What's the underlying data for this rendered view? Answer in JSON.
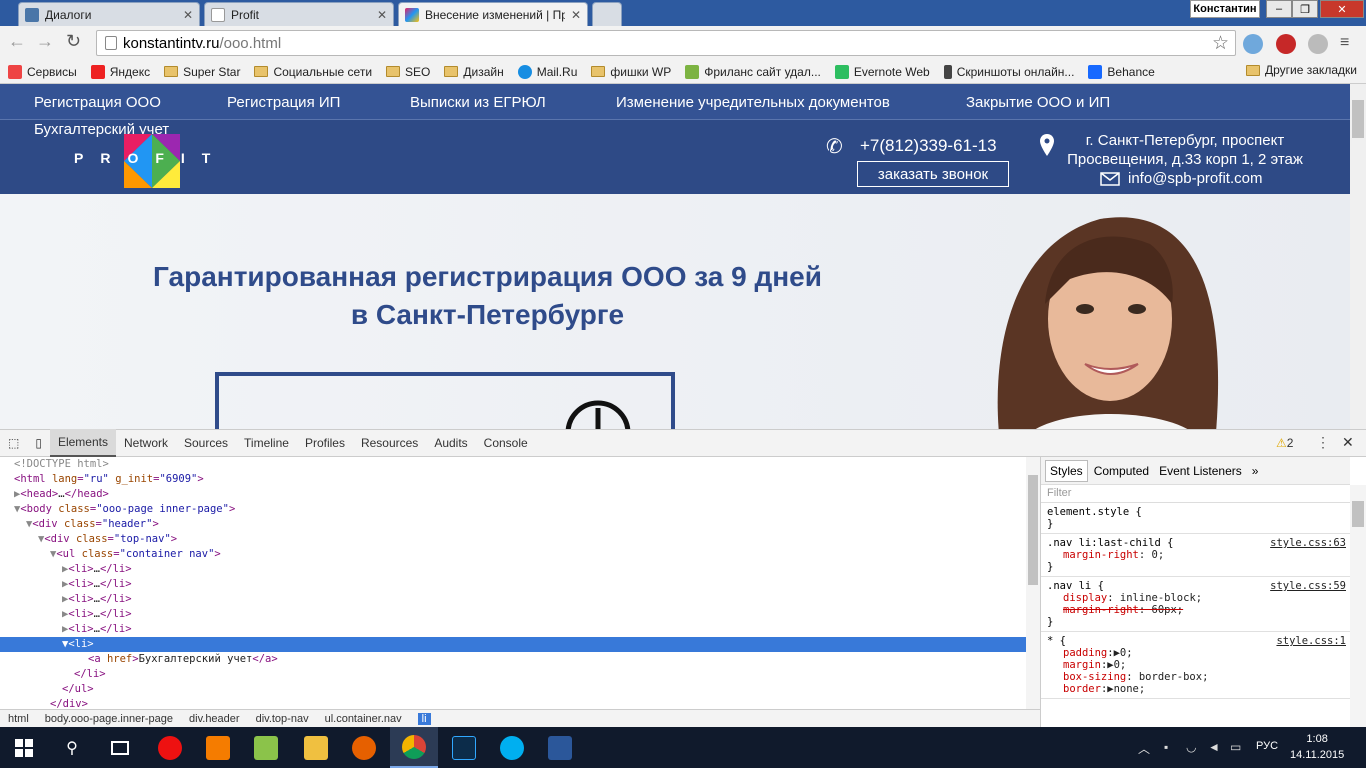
{
  "tabs": [
    {
      "title": "Диалоги",
      "color": "#4a76a8"
    },
    {
      "title": "Profit",
      "color": "#cccccc"
    },
    {
      "title": "Внесение изменений | Пр",
      "color": "#c2185b"
    }
  ],
  "window": {
    "user": "Константин",
    "minimize": "–",
    "maximize": "❐",
    "close": "✕"
  },
  "toolbar": {
    "back": "←",
    "forward": "→",
    "reload": "↻",
    "url_host": "konstantintv.ru",
    "url_path": "/ooo.html",
    "star": "☆"
  },
  "bookmarks": {
    "items": [
      {
        "label": "Сервисы",
        "icon": "apps-icon",
        "color": "#e44"
      },
      {
        "label": "Яндекс",
        "icon": "yandex-icon",
        "color": "#e22"
      },
      {
        "label": "Super Star",
        "icon": "folder-icon"
      },
      {
        "label": "Социальные сети",
        "icon": "folder-icon"
      },
      {
        "label": "SEO",
        "icon": "folder-icon"
      },
      {
        "label": "Дизайн",
        "icon": "folder-icon"
      },
      {
        "label": "Mail.Ru",
        "icon": "mailru-icon",
        "color": "#168de2"
      },
      {
        "label": "фишки WP",
        "icon": "folder-icon"
      },
      {
        "label": "Фриланс сайт удал...",
        "icon": "fl-icon",
        "color": "#7cb342"
      },
      {
        "label": "Evernote Web",
        "icon": "evernote-icon",
        "color": "#2dbe60"
      },
      {
        "label": "Скриншоты онлайн...",
        "icon": "p-icon",
        "color": "#444"
      },
      {
        "label": "Behance",
        "icon": "behance-icon",
        "color": "#1769ff"
      }
    ],
    "other": "Другие закладки"
  },
  "site": {
    "nav": [
      "Регистрация ООО",
      "Регистрация ИП",
      "Выписки из ЕГРЮЛ",
      "Изменение учредительных документов",
      "Закрытие ООО и ИП",
      "Бухгалтерский учет"
    ],
    "logo": "PROFIT",
    "phone": "+7(812)339-61-13",
    "callback": "заказать звонок",
    "address": "г. Санкт-Петербург, проспект Просвещения, д.33 корп 1, 2 этаж",
    "email": "info@spb-profit.com",
    "headline1": "Гарантированная регистрирация ООО за 9 дней",
    "headline2": "в Санкт-Петербурге"
  },
  "devtools": {
    "tabs": [
      "Elements",
      "Network",
      "Sources",
      "Timeline",
      "Profiles",
      "Resources",
      "Audits",
      "Console"
    ],
    "warnings": "2",
    "breadcrumbs": [
      "html",
      "body.ooo-page.inner-page",
      "div.header",
      "div.top-nav",
      "ul.container.nav",
      "li"
    ],
    "styles_tabs": [
      "Styles",
      "Computed",
      "Event Listeners"
    ],
    "filter": "Filter"
  },
  "taskbar": {
    "lang": "РУС",
    "time": "1:08",
    "date": "14.11.2015"
  }
}
